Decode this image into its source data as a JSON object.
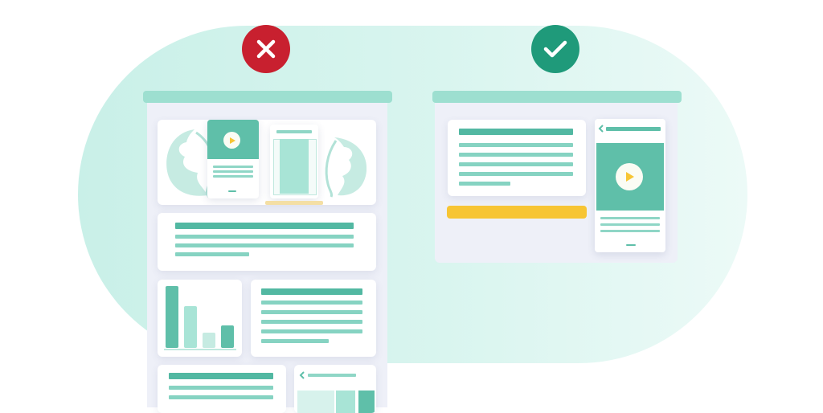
{
  "illustration": {
    "badges": [
      {
        "name": "wrong-layout-badge",
        "icon": "close-x-icon",
        "color": "#c8202f"
      },
      {
        "name": "correct-layout-badge",
        "icon": "checkmark-icon",
        "color": "#1f9a7a"
      }
    ],
    "colors": {
      "accent_teal": "#5fbfa9",
      "light_teal": "#a8e4d6",
      "yellow_bar": "#f7c534",
      "play_icon": "#f7c534",
      "background_blob": "#d4f3ec"
    },
    "icons": [
      "close-x-icon",
      "checkmark-icon",
      "play-icon",
      "chevron-left-icon",
      "monstera-leaf-icon",
      "bar-chart-icon"
    ]
  }
}
